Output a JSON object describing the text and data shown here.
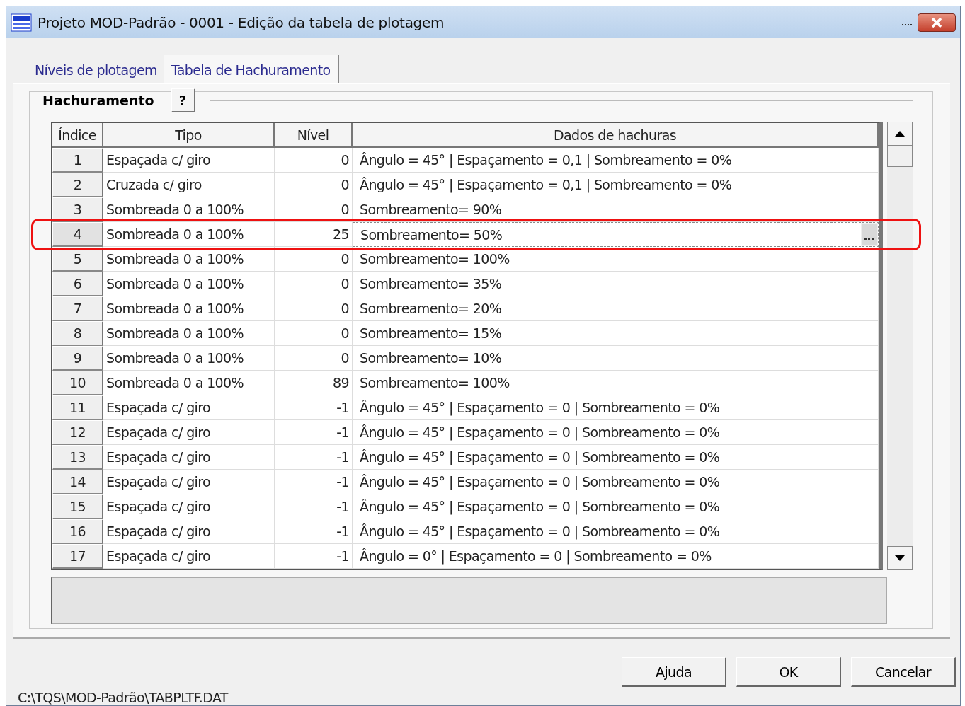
{
  "window": {
    "title": "Projeto MOD-Padrão - 0001 - Edição da tabela de plotagem"
  },
  "tabs": [
    {
      "label": "Níveis de plotagem",
      "selected": false
    },
    {
      "label": "Tabela de Hachuramento",
      "selected": true
    }
  ],
  "group": {
    "title": "Hachuramento",
    "help_button": "?"
  },
  "table": {
    "columns": [
      "Índice",
      "Tipo",
      "Nível",
      "Dados de hachuras"
    ],
    "rows": [
      {
        "cells": [
          "1",
          "Espaçada c/ giro",
          "0",
          "Ângulo = 45° | Espaçamento = 0,1 | Sombreamento = 0%"
        ],
        "selected": false
      },
      {
        "cells": [
          "2",
          "Cruzada c/ giro",
          "0",
          "Ângulo = 45° | Espaçamento = 0,1 | Sombreamento = 0%"
        ],
        "selected": false
      },
      {
        "cells": [
          "3",
          "Sombreada 0 a 100%",
          "0",
          "Sombreamento= 90%"
        ],
        "selected": false
      },
      {
        "cells": [
          "4",
          "Sombreada 0 a 100%",
          "25",
          "Sombreamento= 50%"
        ],
        "selected": true
      },
      {
        "cells": [
          "5",
          "Sombreada 0 a 100%",
          "0",
          "Sombreamento= 100%"
        ],
        "selected": false
      },
      {
        "cells": [
          "6",
          "Sombreada 0 a 100%",
          "0",
          "Sombreamento= 35%"
        ],
        "selected": false
      },
      {
        "cells": [
          "7",
          "Sombreada 0 a 100%",
          "0",
          "Sombreamento= 20%"
        ],
        "selected": false
      },
      {
        "cells": [
          "8",
          "Sombreada 0 a 100%",
          "0",
          "Sombreamento= 15%"
        ],
        "selected": false
      },
      {
        "cells": [
          "9",
          "Sombreada 0 a 100%",
          "0",
          "Sombreamento= 10%"
        ],
        "selected": false
      },
      {
        "cells": [
          "10",
          "Sombreada 0 a 100%",
          "89",
          "Sombreamento= 100%"
        ],
        "selected": false
      },
      {
        "cells": [
          "11",
          "Espaçada c/ giro",
          "-1",
          "Ângulo = 45° | Espaçamento = 0 | Sombreamento = 0%"
        ],
        "selected": false
      },
      {
        "cells": [
          "12",
          "Espaçada c/ giro",
          "-1",
          "Ângulo = 45° | Espaçamento = 0 | Sombreamento = 0%"
        ],
        "selected": false
      },
      {
        "cells": [
          "13",
          "Espaçada c/ giro",
          "-1",
          "Ângulo = 45° | Espaçamento = 0 | Sombreamento = 0%"
        ],
        "selected": false
      },
      {
        "cells": [
          "14",
          "Espaçada c/ giro",
          "-1",
          "Ângulo = 45° | Espaçamento = 0 | Sombreamento = 0%"
        ],
        "selected": false
      },
      {
        "cells": [
          "15",
          "Espaçada c/ giro",
          "-1",
          "Ângulo = 45° | Espaçamento = 0 | Sombreamento = 0%"
        ],
        "selected": false
      },
      {
        "cells": [
          "16",
          "Espaçada c/ giro",
          "-1",
          "Ângulo = 45° | Espaçamento = 0 | Sombreamento = 0%"
        ],
        "selected": false
      },
      {
        "cells": [
          "17",
          "Espaçada c/ giro",
          "-1",
          "Ângulo = 0° | Espaçamento = 0 | Sombreamento = 0%"
        ],
        "selected": false
      }
    ]
  },
  "annotation": {
    "kind": "ring"
  },
  "buttons": [
    "Ajuda",
    "OK",
    "Cancelar"
  ],
  "status_bar": "C:\\TQS\\MOD-Padrão\\TABPLTF.DAT"
}
